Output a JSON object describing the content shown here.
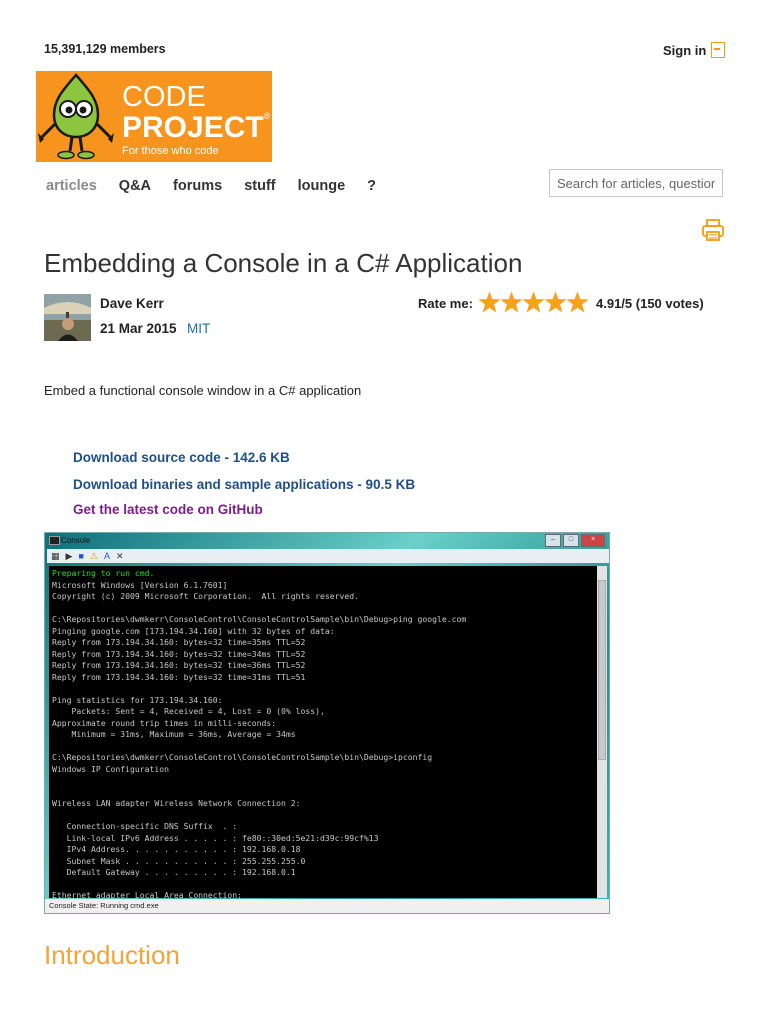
{
  "header": {
    "members": "15,391,129 members",
    "sign_in": "Sign in"
  },
  "logo": {
    "line1": "CODE",
    "line2": "PROJECT",
    "reg": "®",
    "tagline": "For those who code"
  },
  "nav": {
    "items": [
      "articles",
      "Q&A",
      "forums",
      "stuff",
      "lounge",
      "?"
    ]
  },
  "search": {
    "placeholder": "Search for articles, questions, tips"
  },
  "article": {
    "title": "Embedding a Console in a C# Application",
    "author": "Dave Kerr",
    "date": "21 Mar 2015",
    "license": "MIT",
    "rate_label": "Rate me:",
    "rating": "4.91/5 (150 votes)",
    "stars": 5,
    "summary": "Embed a functional console window in a C# application",
    "download_source": "Download source code - 142.6 KB",
    "download_binaries": "Download binaries and sample applications - 90.5 KB",
    "github": "Get the latest code on GitHub",
    "intro_heading": "Introduction"
  },
  "screenshot": {
    "window_title": "Console",
    "status": "Console State:  Running cmd.exe",
    "console_first_line": "Preparing to run cmd.",
    "console_lines": "Microsoft Windows [Version 6.1.7601]\nCopyright (c) 2009 Microsoft Corporation.  All rights reserved.\n\nC:\\Repositories\\dwmkerr\\ConsoleControl\\ConsoleControlSample\\bin\\Debug>ping google.com\nPinging google.com [173.194.34.160] with 32 bytes of data:\nReply from 173.194.34.160: bytes=32 time=35ms TTL=52\nReply from 173.194.34.160: bytes=32 time=34ms TTL=52\nReply from 173.194.34.160: bytes=32 time=36ms TTL=52\nReply from 173.194.34.160: bytes=32 time=31ms TTL=51\n\nPing statistics for 173.194.34.160:\n    Packets: Sent = 4, Received = 4, Lost = 0 (0% loss),\nApproximate round trip times in milli-seconds:\n    Minimum = 31ms, Maximum = 36ms, Average = 34ms\n\nC:\\Repositories\\dwmkerr\\ConsoleControl\\ConsoleControlSample\\bin\\Debug>ipconfig\nWindows IP Configuration\n\n\nWireless LAN adapter Wireless Network Connection 2:\n\n   Connection-specific DNS Suffix  . :\n   Link-local IPv6 Address . . . . . : fe80::30ed:5e21:d39c:99cf%13\n   IPv4 Address. . . . . . . . . . . : 192.168.0.18\n   Subnet Mask . . . . . . . . . . . : 255.255.255.0\n   Default Gateway . . . . . . . . . : 192.168.0.1\n\nEthernet adapter Local Area Connection:"
  },
  "colors": {
    "brand_orange": "#f7941d",
    "link_blue": "#1e4f86",
    "github_purple": "#7b1f8a",
    "star_orange": "#f7a21b"
  }
}
